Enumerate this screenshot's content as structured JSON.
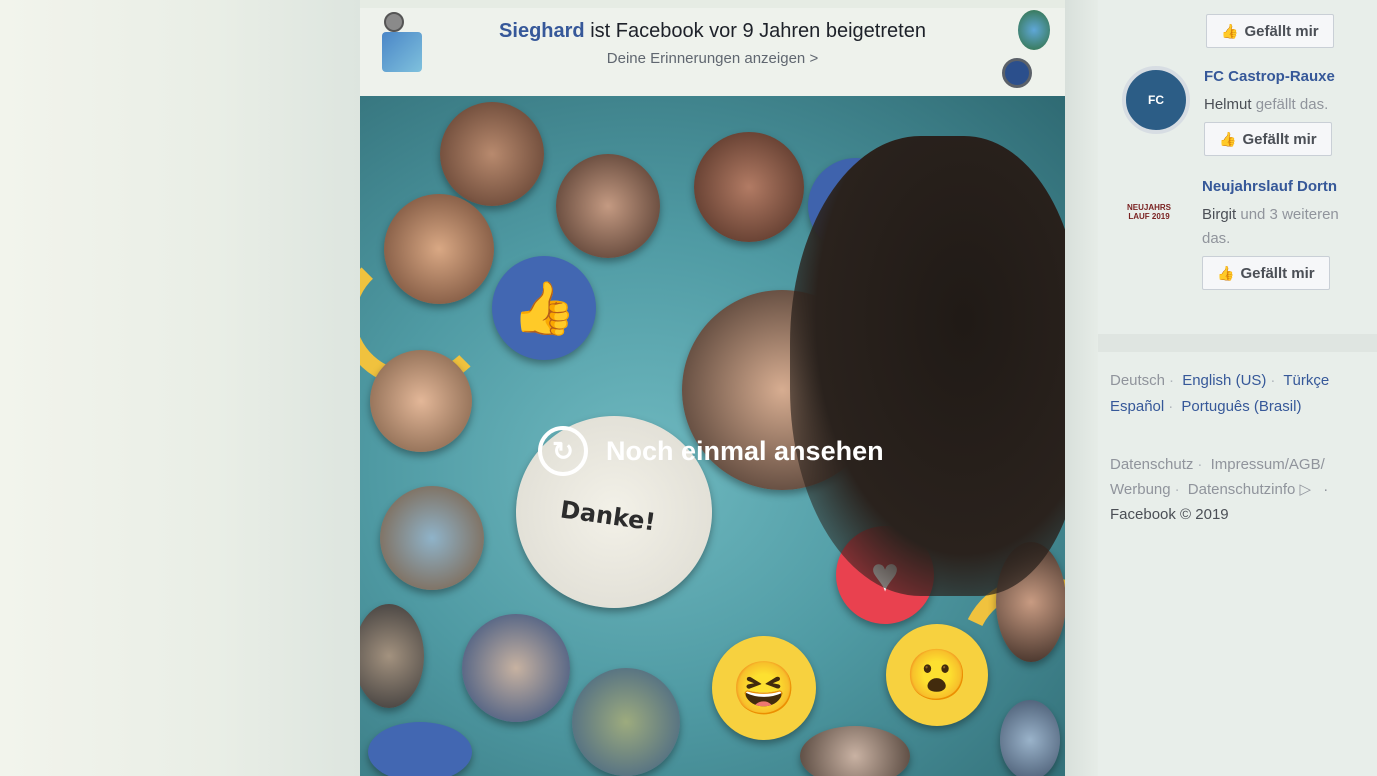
{
  "memory": {
    "name": "Sieghard",
    "title_rest": "ist Facebook vor 9 Jahren beigetreten",
    "link": "Deine Erinnerungen anzeigen",
    "chevron": ">"
  },
  "video": {
    "replay_label": "Noch einmal ansehen",
    "danke": "Danke!"
  },
  "sidebar": {
    "top_like_label": "Gefällt mir",
    "pages": [
      {
        "name": "FC Castrop-Rauxe",
        "friends": "Helmut",
        "suffix": "gefällt das.",
        "like_label": "Gefällt mir",
        "logo_text": "FC"
      },
      {
        "name": "Neujahrslauf Dortn",
        "friends": "Birgit",
        "suffix": "und 3 weiteren",
        "suffix2": "das.",
        "like_label": "Gefällt mir",
        "logo_text": "NEUJAHRS LAUF 2019"
      }
    ],
    "languages": [
      "Deutsch",
      "English (US)",
      "Türkçe",
      "Español",
      "Português (Brasil)"
    ],
    "footer_links": [
      "Datenschutz",
      "Impressum/AGB/",
      "Werbung",
      "Datenschutzinfo ▷",
      "·"
    ],
    "copyright": "Facebook © 2019"
  },
  "colors": {
    "link_blue": "#365899",
    "like_blue": "#4267b2",
    "love_red": "#e9414f",
    "haha_yellow": "#f7d13f"
  },
  "icons": [
    "thumbs-up-icon",
    "replay-icon",
    "heart-icon",
    "laugh-emoji-icon",
    "wow-emoji-icon",
    "chevron-right-icon"
  ]
}
